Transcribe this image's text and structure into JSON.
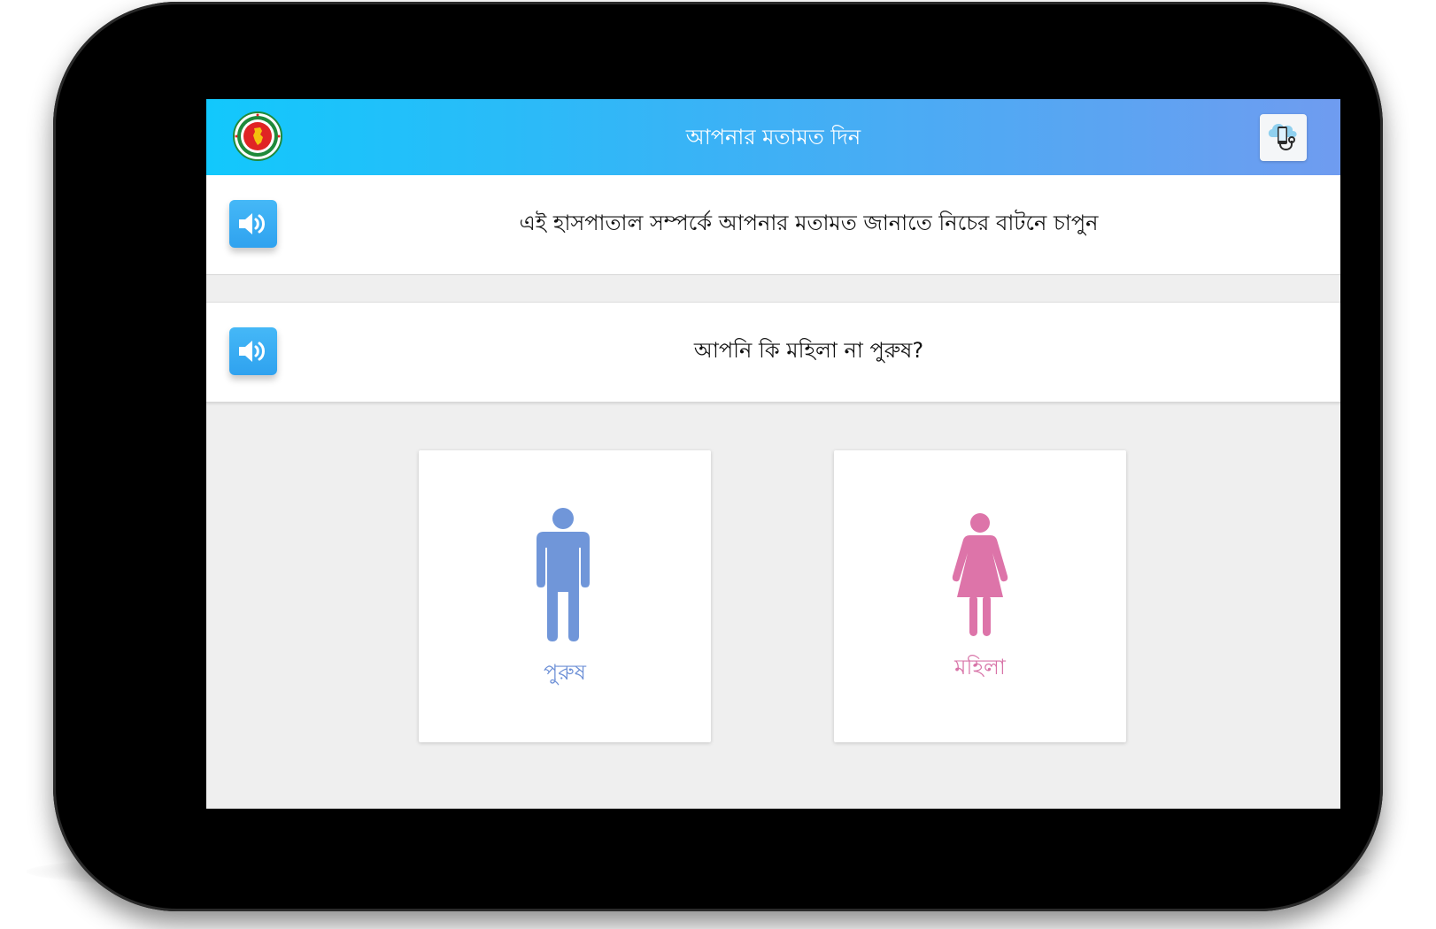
{
  "app": {
    "title": "আপনার মতামত দিন"
  },
  "prompts": [
    {
      "text": "এই হাসপাতাল সম্পর্কে আপনার মতামত জানাতে নিচের বাটনে চাপুন"
    },
    {
      "text": "আপনি কি মহিলা না পুরুষ?"
    }
  ],
  "choices": {
    "male": {
      "label": "পুরুষ",
      "icon": "male-person-icon",
      "color": "#6c8fd6"
    },
    "female": {
      "label": "মহিলা",
      "icon": "female-person-icon",
      "color": "#d874a8"
    }
  },
  "icons": {
    "logo": "government-seal-logo",
    "speaker": "speaker-icon",
    "telemedicine": "cloud-stethoscope-icon"
  },
  "colors": {
    "appbar_start": "#12c8fc",
    "appbar_end": "#6f9cf0",
    "speaker_button": "#3aaef3"
  }
}
